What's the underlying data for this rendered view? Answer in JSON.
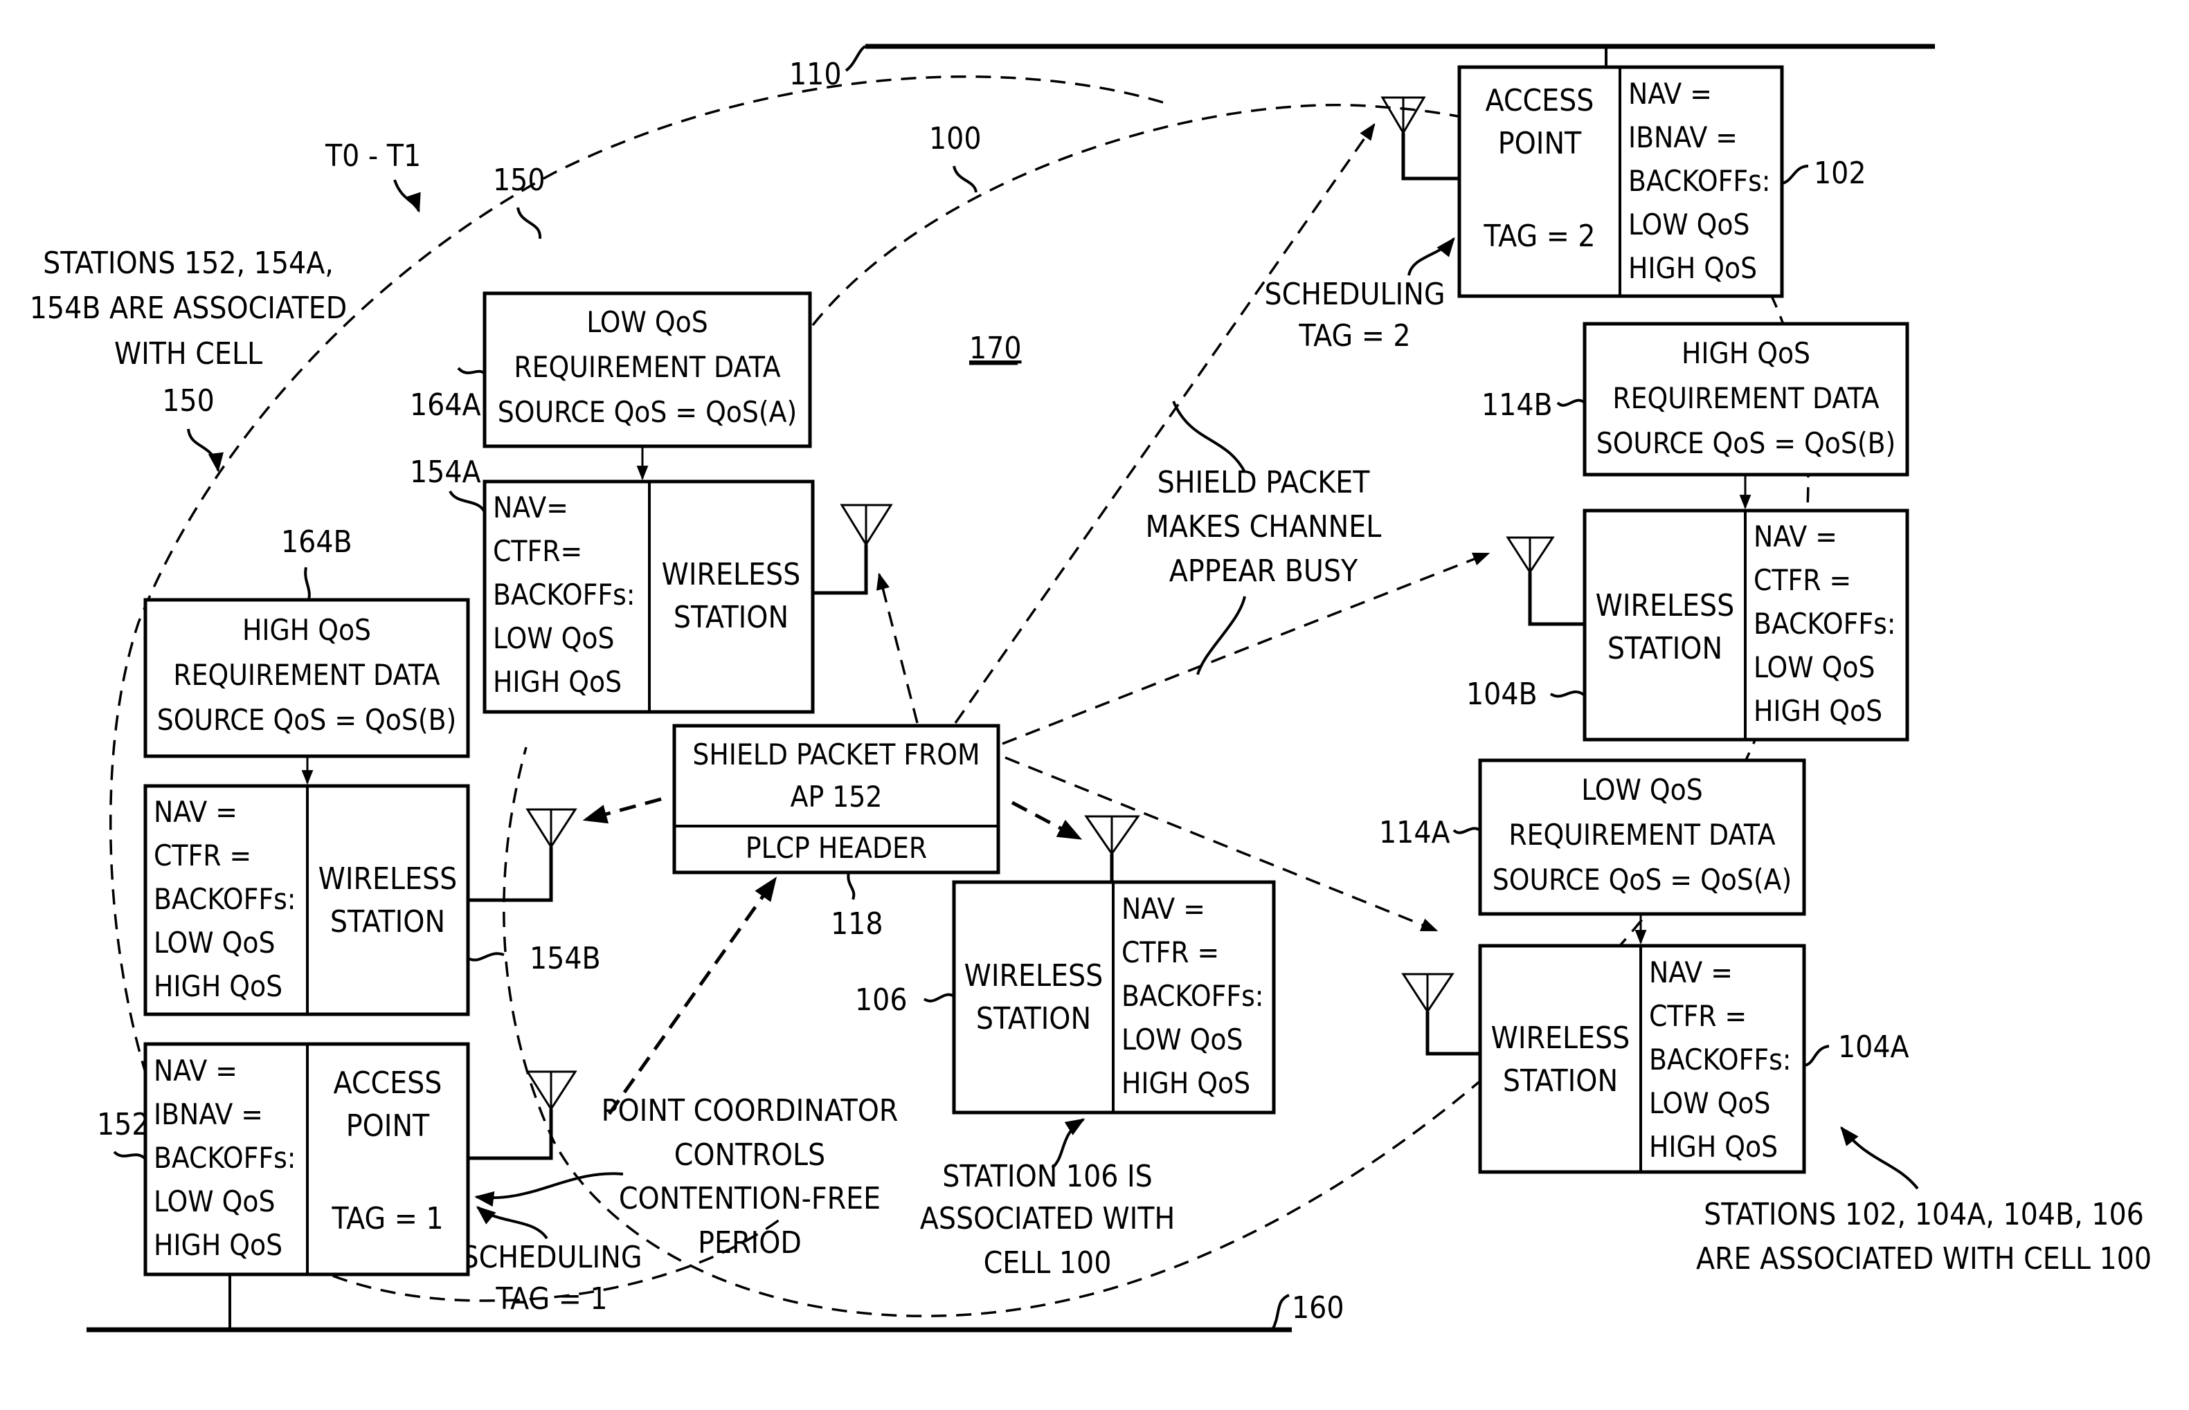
{
  "figure": {
    "period_label": "T0 - T1",
    "region_label": "170",
    "cells": {
      "cell_100": {
        "ref": "100"
      },
      "cell_150": {
        "ref": "150"
      }
    },
    "buses": {
      "top": {
        "ref": "110"
      },
      "bottom": {
        "ref": "160"
      }
    }
  },
  "annotations": {
    "cell150_note": [
      "STATIONS 152, 154A,",
      "154B ARE ASSOCIATED",
      "WITH CELL",
      "150"
    ],
    "cell100_note": [
      "STATIONS 102, 104A, 104B, 106",
      "ARE ASSOCIATED WITH CELL 100"
    ],
    "station106_note": [
      "STATION 106 IS",
      "ASSOCIATED WITH",
      "CELL 100"
    ],
    "shield_note": [
      "SHIELD PACKET",
      "MAKES CHANNEL",
      "APPEAR BUSY"
    ],
    "point_coordinator_note": [
      "POINT COORDINATOR",
      "CONTROLS",
      "CONTENTION-FREE",
      "PERIOD"
    ],
    "sched_tag_1": [
      "SCHEDULING",
      "TAG = 1"
    ],
    "sched_tag_2": [
      "SCHEDULING",
      "TAG = 2"
    ]
  },
  "nodes": {
    "ap102": {
      "ref": "102",
      "title": [
        "ACCESS",
        "POINT"
      ],
      "tag": "TAG = 2",
      "fields": [
        "NAV =",
        "IBNAV =",
        "BACKOFFs:",
        "LOW QoS",
        "HIGH QoS"
      ]
    },
    "ap152": {
      "ref": "152",
      "title": [
        "ACCESS",
        "POINT"
      ],
      "tag": "TAG = 1",
      "fields": [
        "NAV =",
        "IBNAV =",
        "BACKOFFs:",
        "LOW QoS",
        "HIGH QoS"
      ]
    },
    "ws104a": {
      "ref": "104A",
      "title": [
        "WIRELESS",
        "STATION"
      ],
      "fields": [
        "NAV =",
        "CTFR =",
        "BACKOFFs:",
        "LOW QoS",
        "HIGH QoS"
      ]
    },
    "ws104b": {
      "ref": "104B",
      "title": [
        "WIRELESS",
        "STATION"
      ],
      "fields": [
        "NAV =",
        "CTFR =",
        "BACKOFFs:",
        "LOW QoS",
        "HIGH QoS"
      ]
    },
    "ws106": {
      "ref": "106",
      "title": [
        "WIRELESS",
        "STATION"
      ],
      "fields": [
        "NAV =",
        "CTFR =",
        "BACKOFFs:",
        "LOW QoS",
        "HIGH QoS"
      ]
    },
    "ws154a": {
      "ref": "154A",
      "title": [
        "WIRELESS",
        "STATION"
      ],
      "fields": [
        "NAV=",
        "CTFR=",
        "BACKOFFs:",
        "LOW QoS",
        "HIGH QoS"
      ]
    },
    "ws154b": {
      "ref": "154B",
      "title": [
        "WIRELESS",
        "STATION"
      ],
      "fields": [
        "NAV =",
        "CTFR =",
        "BACKOFFs:",
        "LOW QoS",
        "HIGH QoS"
      ]
    }
  },
  "data_blocks": {
    "d114a": {
      "ref": "114A",
      "lines": [
        "LOW QoS",
        "REQUIREMENT DATA",
        "SOURCE QoS = QoS(A)"
      ]
    },
    "d114b": {
      "ref": "114B",
      "lines": [
        "HIGH QoS",
        "REQUIREMENT DATA",
        "SOURCE QoS = QoS(B)"
      ]
    },
    "d164a": {
      "ref": "164A",
      "lines": [
        "LOW QoS",
        "REQUIREMENT DATA",
        "SOURCE QoS = QoS(A)"
      ]
    },
    "d164b": {
      "ref": "164B",
      "lines": [
        "HIGH QoS",
        "REQUIREMENT DATA",
        "SOURCE QoS = QoS(B)"
      ]
    }
  },
  "shield_packet": {
    "ref": "118",
    "body": [
      "SHIELD PACKET FROM",
      "AP 152"
    ],
    "header": "PLCP HEADER"
  }
}
